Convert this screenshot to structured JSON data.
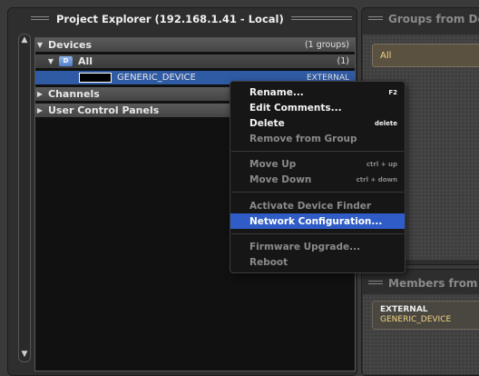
{
  "explorer": {
    "title": "Project Explorer (192.168.1.41 - Local)",
    "tree": {
      "devices": {
        "label": "Devices",
        "count": "(1 groups)"
      },
      "all_group": {
        "label": "All",
        "count": "(1)",
        "folder_letter": "D"
      },
      "device": {
        "name": "GENERIC_DEVICE",
        "type": "EXTERNAL"
      },
      "channels": {
        "label": "Channels"
      },
      "user_control_panels": {
        "label": "User Control Panels"
      }
    }
  },
  "groups_panel": {
    "title": "Groups from Dev",
    "group_label": "All"
  },
  "members_panel": {
    "title": "Members from De",
    "member_type": "EXTERNAL",
    "member_name": "GENERIC_DEVICE"
  },
  "context_menu": {
    "items": [
      {
        "label": "Rename...",
        "shortcut": "F2"
      },
      {
        "label": "Edit Comments...",
        "shortcut": ""
      },
      {
        "label": "Delete",
        "shortcut": "delete"
      },
      {
        "label": "Remove from Group",
        "shortcut": ""
      },
      {
        "label": "Move Up",
        "shortcut": "ctrl + up"
      },
      {
        "label": "Move Down",
        "shortcut": "ctrl + down"
      },
      {
        "label": "Activate Device Finder",
        "shortcut": ""
      },
      {
        "label": "Network Configuration...",
        "shortcut": ""
      },
      {
        "label": "Firmware Upgrade...",
        "shortcut": ""
      },
      {
        "label": "Reboot",
        "shortcut": ""
      }
    ]
  },
  "colors": {
    "selection": "#2f5aa4",
    "menu_highlight": "#2f5cc7",
    "group_text": "#f3d585"
  }
}
